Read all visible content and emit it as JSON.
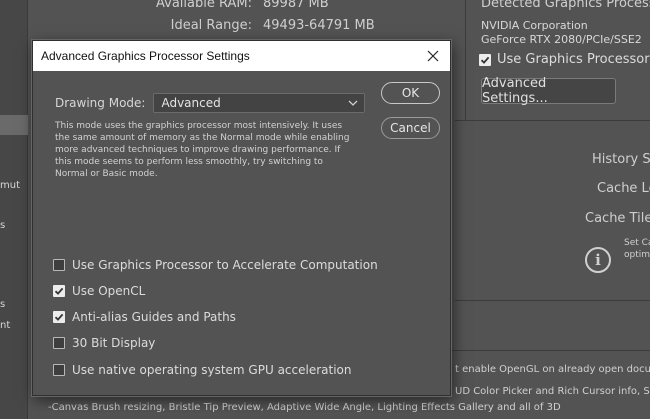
{
  "background": {
    "memory": {
      "available_label": "Available RAM:",
      "available_value": "89987 MB",
      "ideal_label": "Ideal Range:",
      "ideal_value": "49493-64791 MB"
    },
    "gpu": {
      "title": "Detected Graphics Processor:",
      "vendor": "NVIDIA Corporation",
      "model": "GeForce RTX 2080/PCIe/SSE2",
      "use_gpu_label": "Use Graphics Processor",
      "use_gpu_checked": true,
      "advanced_button": "Advanced Settings..."
    },
    "right_labels": {
      "history": "History Sta",
      "cache_levels": "Cache Lev",
      "cache_tile": "Cache Tile S",
      "note_line1": "Set Ca",
      "note_line2": "optim"
    },
    "left_fragments": [
      "mut",
      "s",
      "s",
      "nt"
    ],
    "footer": {
      "line1": "t enable OpenGL on already open documents",
      "line2": "UD Color Picker and Rich Cursor info, Sampl",
      "line3": "-Canvas Brush resizing, Bristle Tip Preview, Adaptive Wide Angle, Lighting Effects Gallery and all of 3D"
    }
  },
  "dialog": {
    "title": "Advanced Graphics Processor Settings",
    "drawing_mode_label": "Drawing Mode:",
    "drawing_mode_value": "Advanced",
    "description_lines": [
      "This mode uses the graphics processor most intensively.  It uses",
      "the same amount of memory as the Normal mode while enabling",
      "more advanced techniques to improve drawing performance.  If",
      "this mode seems to perform less smoothly, try switching to",
      "Normal or Basic mode."
    ],
    "ok_label": "OK",
    "cancel_label": "Cancel",
    "options": [
      {
        "label": "Use Graphics Processor to Accelerate Computation",
        "checked": false
      },
      {
        "label": "Use OpenCL",
        "checked": true
      },
      {
        "label": "Anti-alias Guides and Paths",
        "checked": true
      },
      {
        "label": "30 Bit Display",
        "checked": false
      },
      {
        "label": "Use native operating system GPU acceleration",
        "checked": false
      }
    ]
  },
  "icons": {
    "close": "close-icon",
    "chevron": "chevron-down-icon",
    "info": "info-icon",
    "check": "checkmark-icon"
  },
  "colors": {
    "panel_bg": "#535353",
    "title_bar_bg": "#ffffff",
    "text": "#d6d6d6"
  }
}
